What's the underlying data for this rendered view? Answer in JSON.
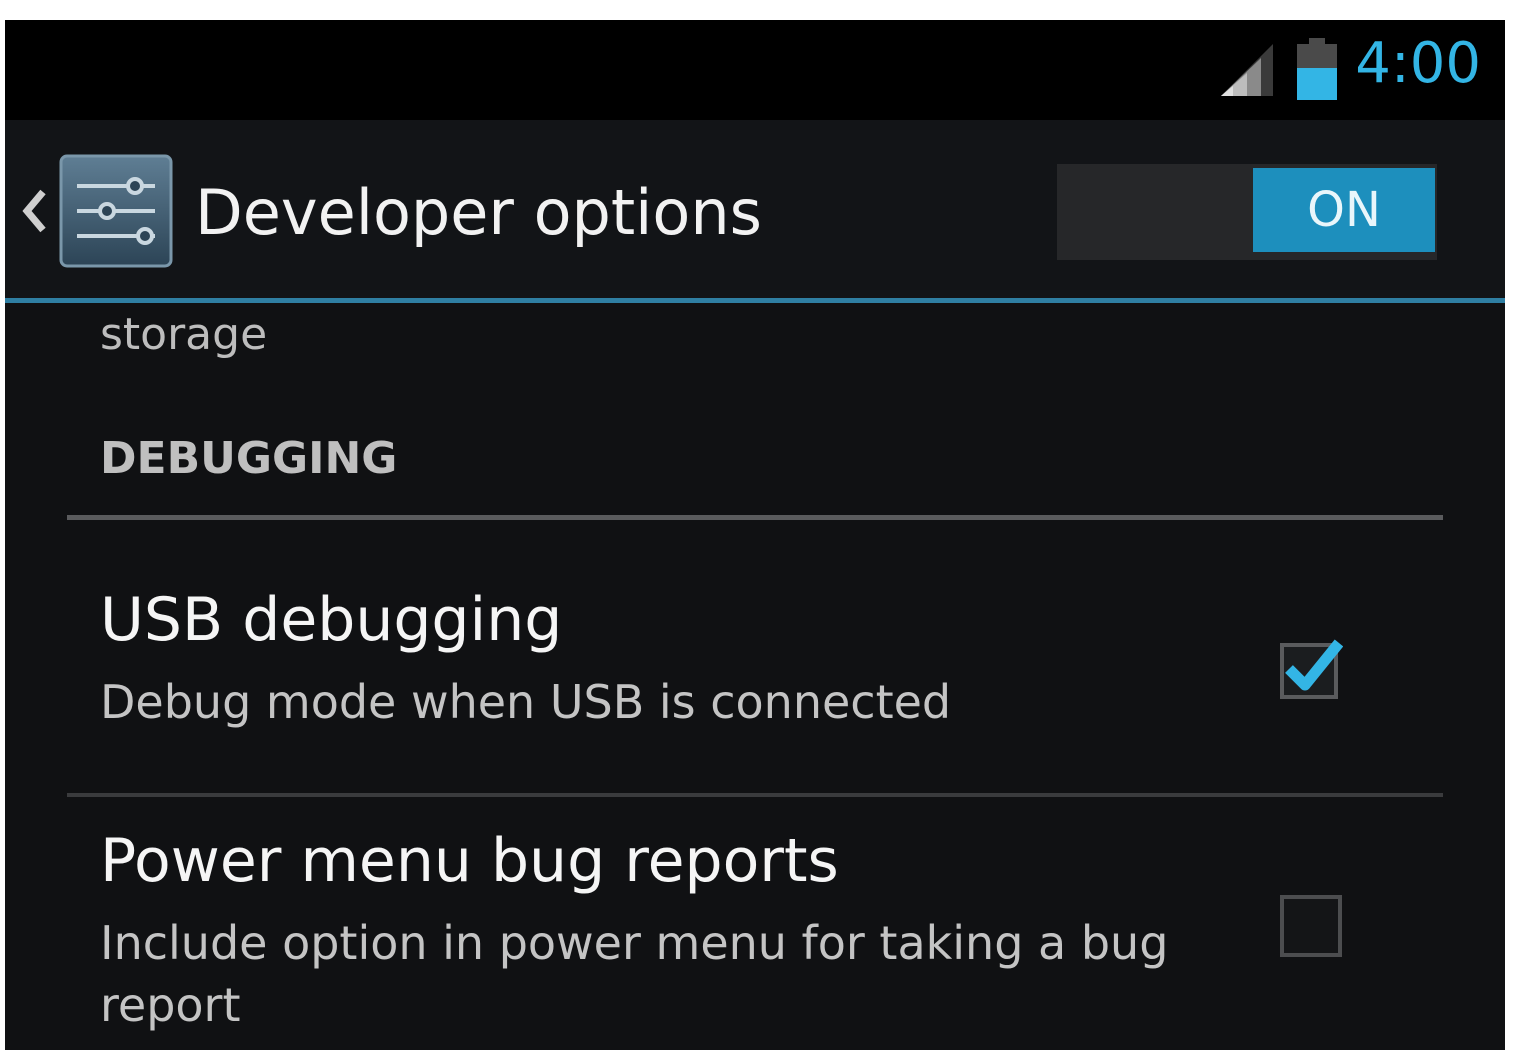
{
  "status_bar": {
    "time": "4:00",
    "signal_icon": "signal-icon",
    "battery_icon": "battery-icon"
  },
  "action_bar": {
    "title": "Developer options",
    "app_icon": "developer-options-sliders-icon",
    "master_switch": {
      "label": "ON",
      "state": "on"
    }
  },
  "content": {
    "previous_item_summary": "storage",
    "section_header": "DEBUGGING",
    "preferences": [
      {
        "title": "USB debugging",
        "summary": "Debug mode when USB is connected",
        "checked": true
      },
      {
        "title": "Power menu bug reports",
        "summary": "Include option in power menu for taking a bug report",
        "checked": false
      }
    ]
  },
  "colors": {
    "accent": "#33b5e5",
    "switch_on": "#1d8fbd",
    "background": "#101113",
    "divider": "#2f7fa3"
  }
}
